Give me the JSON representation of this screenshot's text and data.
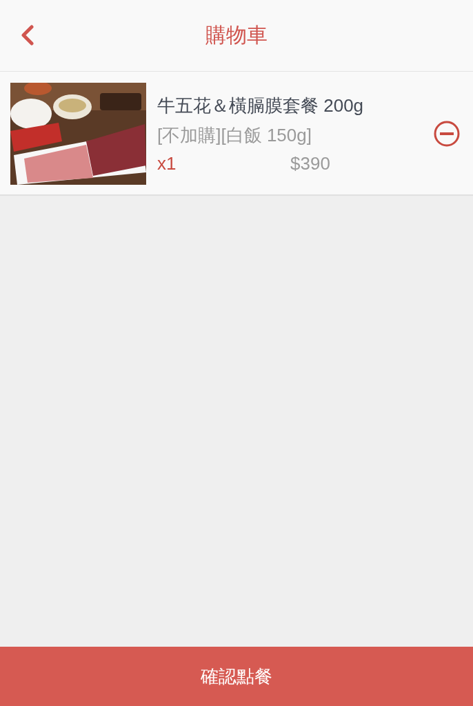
{
  "header": {
    "title": "購物車"
  },
  "cart_items": [
    {
      "kind": "picture",
      "name": "牛五花＆橫膈膜套餐 200g",
      "options": "[不加購][白飯 150g]",
      "quantity": "x1",
      "price": "$390"
    }
  ],
  "confirm_button": {
    "label": "確認點餐"
  }
}
